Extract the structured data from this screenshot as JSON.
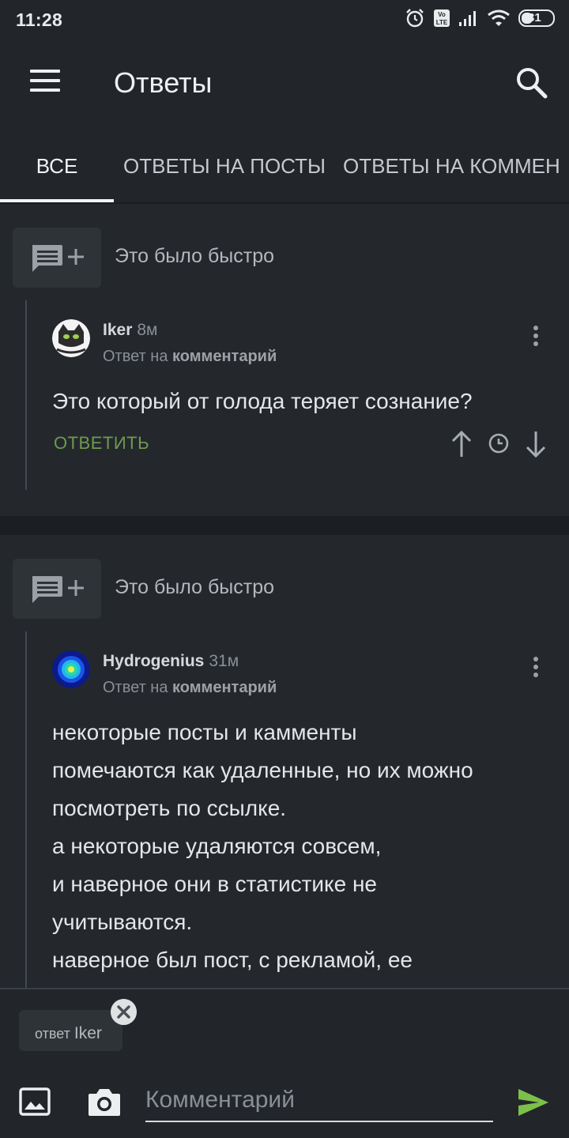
{
  "status_bar": {
    "time": "11:28",
    "battery": "31"
  },
  "app_bar": {
    "title": "Ответы",
    "menu_icon": "hamburger-menu-icon",
    "search_icon": "search-icon"
  },
  "tabs": [
    {
      "label": "ВСЕ",
      "active": true
    },
    {
      "label": "ОТВЕТЫ НА ПОСТЫ",
      "active": false
    },
    {
      "label": "ОТВЕТЫ НА КОММЕН",
      "active": false
    }
  ],
  "feed": [
    {
      "post_title": "Это было быстро",
      "author": "Iker",
      "time_ago": "8м",
      "reply_prefix": "Ответ на",
      "reply_target": "комментарий",
      "text": "Это который от голода теряет сознание?",
      "reply_label": "ОТВЕТИТЬ"
    },
    {
      "post_title": "Это было быстро",
      "author": "Hydrogenius",
      "time_ago": "31м",
      "reply_prefix": "Ответ на",
      "reply_target": "комментарий",
      "text": "некоторые посты и камменты\nпомечаются как удаленные, но их можно\nпосмотреть по ссылке.\nа некоторые удаляются совсем,\nи наверное они в статистике не\nучитываются.\nнаверное был пост, с рекламой, ее"
    }
  ],
  "compose": {
    "reply_chip_prefix": "ответ",
    "reply_chip_name": "Iker",
    "placeholder": "Комментарий"
  },
  "colors": {
    "background": "#22262b",
    "card": "#24282d",
    "accent_green": "#6f9a4e",
    "send_green": "#7cc04b"
  }
}
